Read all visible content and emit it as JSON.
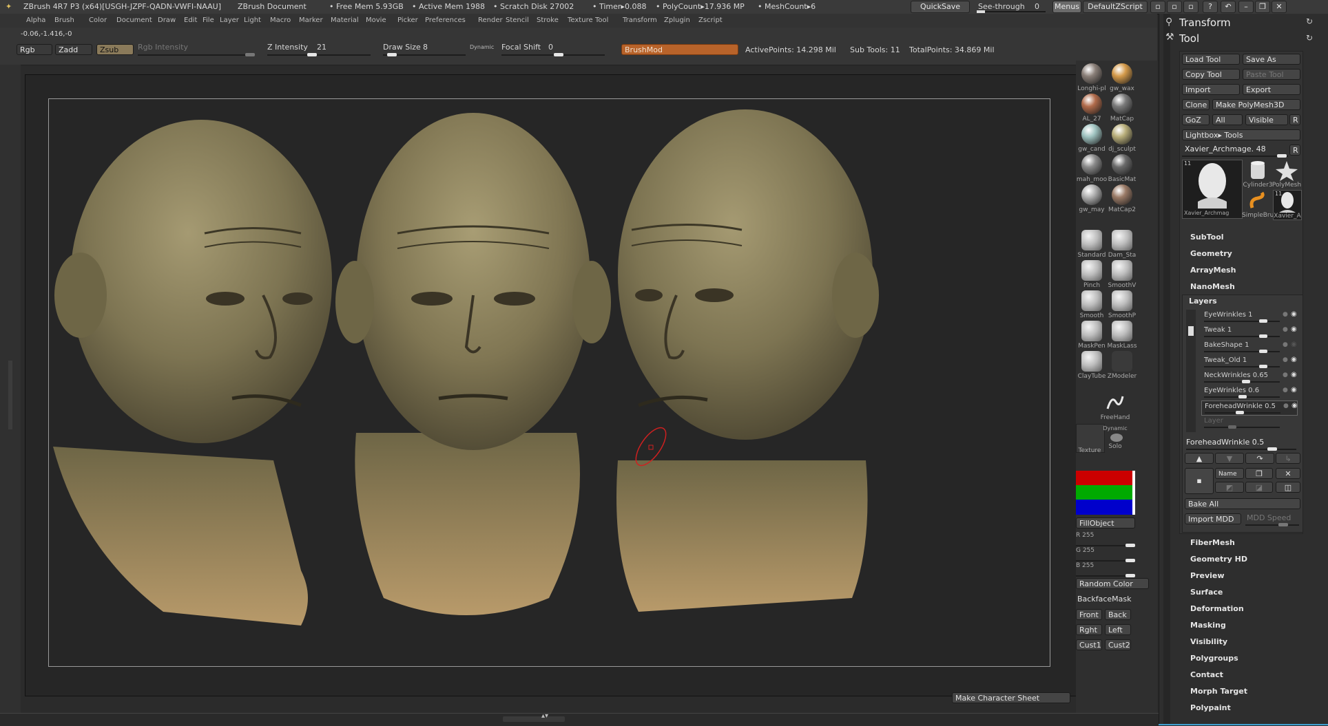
{
  "titlebar": {
    "app": "ZBrush 4R7 P3 (x64)[USGH-JZPF-QADN-VWFI-NAAU]",
    "doc": "ZBrush Document",
    "free_mem": "• Free Mem 5.93GB",
    "active_mem": "• Active Mem 1988",
    "scratch": "• Scratch Disk 27002",
    "timer": "• Timer▸0.088",
    "polycount": "• PolyCount▸17.936 MP",
    "meshcount": "• MeshCount▸6",
    "quicksave": "QuickSave",
    "see_through": "See-through",
    "see_through_value": "0",
    "menus": "Menus",
    "script": "DefaultZScript"
  },
  "menu": [
    "Alpha",
    "Brush",
    "Color",
    "Document",
    "Draw",
    "Edit",
    "File",
    "Layer",
    "Light",
    "Macro",
    "Marker",
    "Material",
    "Movie",
    "Picker",
    "Preferences",
    "Render",
    "Stencil",
    "Stroke",
    "Texture",
    "Tool",
    "Transform",
    "Zplugin",
    "Zscript"
  ],
  "shelf": {
    "coords": "-0.06,-1.416,-0",
    "rgb": "Rgb",
    "zadd": "Zadd",
    "zsub": "Zsub",
    "rgb_intensity": "Rgb Intensity",
    "z_intensity_label": "Z Intensity",
    "z_intensity_value": "21",
    "draw_size_label": "Draw Size",
    "draw_size_value": "8",
    "dynamic": "Dynamic",
    "focal_label": "Focal Shift",
    "focal_value": "0",
    "brushmod": "BrushMod",
    "active_points": "ActivePoints: 14.298 Mil",
    "sub_tools": "Sub Tools: 11",
    "total_points": "TotalPoints: 34.869 Mil"
  },
  "materials": [
    {
      "label": "Longhi-pl",
      "color": "#8a7f78"
    },
    {
      "label": "gw_wax",
      "color": "#d49a4a"
    },
    {
      "label": "AL_27",
      "color": "#b06a4a"
    },
    {
      "label": "MatCap",
      "color": "#7a7a7a"
    },
    {
      "label": "gw_cand",
      "color": "#9fc3c0"
    },
    {
      "label": "dj_sculpt",
      "color": "#b8ae7a"
    },
    {
      "label": "mah_moo",
      "color": "#8a8a8a"
    },
    {
      "label": "BasicMat",
      "color": "#6a6a6a"
    },
    {
      "label": "gw_may",
      "color": "#b0b0b0"
    },
    {
      "label": "MatCap2",
      "color": "#9a7a66"
    }
  ],
  "brushes": [
    {
      "label": "Standard"
    },
    {
      "label": "Dam_Sta"
    },
    {
      "label": "Pinch"
    },
    {
      "label": "SmoothV"
    },
    {
      "label": "Smooth"
    },
    {
      "label": "SmoothP"
    },
    {
      "label": "MaskPen"
    },
    {
      "label": "MaskLass"
    },
    {
      "label": "ClayTube"
    },
    {
      "label": "ZModeler"
    }
  ],
  "stroke": {
    "freehand": "FreeHand",
    "dynamic": "Dynamic",
    "solo": "Solo",
    "texture": "Texture"
  },
  "color_panel": {
    "fill": "FillObject",
    "r": "R 255",
    "g": "G 255",
    "b": "B 255",
    "random": "Random Color",
    "backface": "BackfaceMask",
    "front": "Front",
    "back": "Back",
    "right": "Rght",
    "left": "Left",
    "cust1": "Cust1",
    "cust2": "Cust2"
  },
  "character_sheet": "Make Character Sheet",
  "tray": {
    "transform": "Transform",
    "tool": "Tool",
    "load": "Load Tool",
    "save": "Save As",
    "copy": "Copy Tool",
    "paste": "Paste Tool",
    "import": "Import",
    "export": "Export",
    "clone": "Clone",
    "polymesh": "Make PolyMesh3D",
    "goz": "GoZ",
    "all": "All",
    "visible": "Visible",
    "r": "R",
    "lightbox": "Lightbox▸ Tools",
    "current_tool": "Xavier_Archmage. 48",
    "thumbs": [
      {
        "label": "Xavier_Archmag",
        "badge": "11"
      },
      {
        "label": "Cylinder3"
      },
      {
        "label": "PolyMesh"
      },
      {
        "label": "SimpleBru"
      },
      {
        "label": "Xavier_A",
        "badge": "11"
      }
    ],
    "sections_top": [
      "SubTool",
      "Geometry",
      "ArrayMesh",
      "NanoMesh"
    ],
    "layers_title": "Layers",
    "layers": [
      {
        "name": "EyeWrinkles 1",
        "level": 0.8
      },
      {
        "name": "Tweak 1",
        "level": 0.8
      },
      {
        "name": "BakeShape 1",
        "level": 0.8
      },
      {
        "name": "Tweak_Old 1",
        "level": 0.8
      },
      {
        "name": "NeckWrinkles 0.65",
        "level": 0.55
      },
      {
        "name": "EyeWrinkles 0.6",
        "level": 0.5
      },
      {
        "name": "ForeheadWrinkle 0.5",
        "level": 0.45
      },
      {
        "name": "Layer",
        "level": 0.35
      }
    ],
    "forehead": "ForeheadWrinkle 0.5",
    "name": "Name",
    "bake_all": "Bake All",
    "import_mdd": "Import MDD",
    "mdd_speed": "MDD Speed",
    "sections_bottom": [
      "FiberMesh",
      "Geometry HD",
      "Preview",
      "Surface",
      "Deformation",
      "Masking",
      "Visibility",
      "Polygroups",
      "Contact",
      "Morph Target",
      "Polypaint"
    ]
  }
}
